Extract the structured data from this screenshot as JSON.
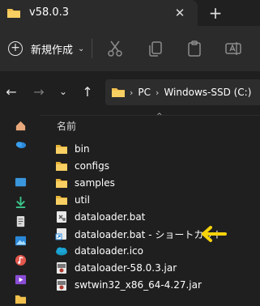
{
  "window": {
    "tab_title": "v58.0.3",
    "close_tab": "✕",
    "new_tab": "+"
  },
  "toolbar": {
    "new_label": "新規作成",
    "new_caret": "⌄",
    "icons": [
      "cut-icon",
      "copy-icon",
      "paste-icon",
      "rename-icon"
    ]
  },
  "address": {
    "back": "←",
    "forward": "→",
    "recent": "⌄",
    "up": "↑",
    "separator": "›",
    "crumbs": [
      "PC",
      "Windows-SSD (C:)"
    ]
  },
  "file_list": {
    "column_name": "名前",
    "sort_indicator": "^",
    "items": [
      {
        "name": "bin",
        "type": "folder"
      },
      {
        "name": "configs",
        "type": "folder"
      },
      {
        "name": "samples",
        "type": "folder"
      },
      {
        "name": "util",
        "type": "folder"
      },
      {
        "name": "dataloader.bat",
        "type": "bat"
      },
      {
        "name": "dataloader.bat - ショートカット",
        "type": "shortcut"
      },
      {
        "name": "dataloader.ico",
        "type": "ico"
      },
      {
        "name": "dataloader-58.0.3.jar",
        "type": "jar"
      },
      {
        "name": "swtwin32_x86_64-4.27.jar",
        "type": "jar"
      }
    ]
  },
  "sidebar_icons": [
    "home-icon",
    "onedrive-icon",
    "desktop-icon",
    "downloads-icon",
    "documents-icon",
    "pictures-icon",
    "music-icon",
    "videos-icon",
    "folder-icon"
  ],
  "colors": {
    "folder": "#f2c14e",
    "accent_arrow": "#f5d20a",
    "background": "#1f1f1f"
  }
}
